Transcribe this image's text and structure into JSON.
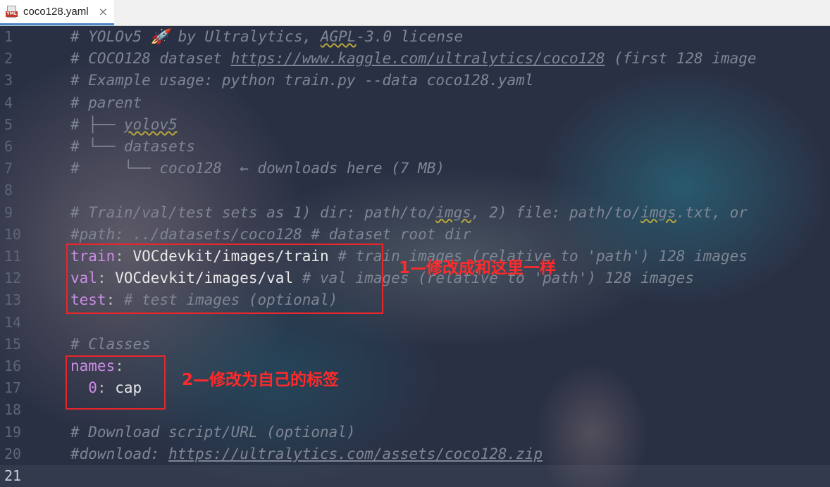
{
  "tab": {
    "title": "coco128.yaml",
    "close": "×",
    "icon_badge": "YML"
  },
  "lines": [
    {
      "n": "1",
      "parts": [
        {
          "t": "# YOLOv5 🚀 by Ultralytics, ",
          "c": "comment"
        },
        {
          "t": "AGPL",
          "c": "comment squig"
        },
        {
          "t": "-3.0 license",
          "c": "comment"
        }
      ]
    },
    {
      "n": "2",
      "parts": [
        {
          "t": "# COCO128 dataset ",
          "c": "comment"
        },
        {
          "t": "https://www.kaggle.com/ultralytics/coco128",
          "c": "comment link"
        },
        {
          "t": " (first 128 image",
          "c": "comment"
        }
      ]
    },
    {
      "n": "3",
      "parts": [
        {
          "t": "# Example usage: python train.py --data coco128.yaml",
          "c": "comment"
        }
      ]
    },
    {
      "n": "4",
      "parts": [
        {
          "t": "# parent",
          "c": "comment"
        }
      ]
    },
    {
      "n": "5",
      "parts": [
        {
          "t": "# ├── ",
          "c": "comment"
        },
        {
          "t": "yolov5",
          "c": "comment squig"
        }
      ]
    },
    {
      "n": "6",
      "parts": [
        {
          "t": "# └── datasets",
          "c": "comment"
        }
      ]
    },
    {
      "n": "7",
      "parts": [
        {
          "t": "#     └── coco128  ← downloads here (7 MB)",
          "c": "comment"
        }
      ]
    },
    {
      "n": "8",
      "parts": []
    },
    {
      "n": "9",
      "parts": [
        {
          "t": "# Train/val/test sets as 1) dir: path/to/",
          "c": "comment"
        },
        {
          "t": "imgs",
          "c": "comment squig"
        },
        {
          "t": ", 2) file: path/to/",
          "c": "comment"
        },
        {
          "t": "imgs",
          "c": "comment squig"
        },
        {
          "t": ".txt, or",
          "c": "comment"
        }
      ]
    },
    {
      "n": "10",
      "parts": [
        {
          "t": "#path: ../datasets/coco128 # dataset root dir",
          "c": "comment"
        }
      ]
    },
    {
      "n": "11",
      "parts": [
        {
          "t": "train",
          "c": "key"
        },
        {
          "t": ": ",
          "c": "punct"
        },
        {
          "t": "VOCdevkit/images/train",
          "c": "val"
        },
        {
          "t": " # train images (relative to 'path') 128 images",
          "c": "comment"
        }
      ]
    },
    {
      "n": "12",
      "parts": [
        {
          "t": "val",
          "c": "key"
        },
        {
          "t": ": ",
          "c": "punct"
        },
        {
          "t": "VOCdevkit/images/val",
          "c": "val"
        },
        {
          "t": " # val images (relative to 'path') 128 images",
          "c": "comment"
        }
      ]
    },
    {
      "n": "13",
      "parts": [
        {
          "t": "test",
          "c": "key"
        },
        {
          "t": ": ",
          "c": "punct"
        },
        {
          "t": "# test images (optional)",
          "c": "comment"
        }
      ]
    },
    {
      "n": "14",
      "parts": []
    },
    {
      "n": "15",
      "parts": [
        {
          "t": "# Classes",
          "c": "comment"
        }
      ]
    },
    {
      "n": "16",
      "parts": [
        {
          "t": "names",
          "c": "key"
        },
        {
          "t": ":",
          "c": "punct"
        }
      ]
    },
    {
      "n": "17",
      "parts": [
        {
          "t": "  0",
          "c": "key"
        },
        {
          "t": ": ",
          "c": "punct"
        },
        {
          "t": "cap",
          "c": "val"
        }
      ]
    },
    {
      "n": "18",
      "parts": []
    },
    {
      "n": "19",
      "parts": [
        {
          "t": "# Download script/URL (optional)",
          "c": "comment"
        }
      ]
    },
    {
      "n": "20",
      "parts": [
        {
          "t": "#download: ",
          "c": "comment"
        },
        {
          "t": "https://ultralytics.com/assets/coco128.zip",
          "c": "comment link"
        }
      ]
    },
    {
      "n": "21",
      "parts": [],
      "current": true
    }
  ],
  "annotations": {
    "note1": "1—修改成和这里一样",
    "note2": "2—修改为自己的标签"
  },
  "colors": {
    "annotation": "#e8262b",
    "comment": "#7f8593",
    "key": "#cb8ce6",
    "value": "#e8e8e8"
  }
}
